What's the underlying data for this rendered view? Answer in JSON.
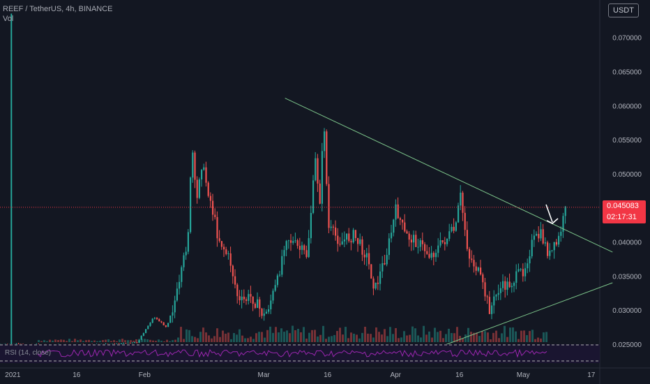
{
  "header": {
    "symbol": "REEF / TetherUS, 4h, BINANCE",
    "volume_label": "Vol"
  },
  "currency_button": "USDT",
  "price_tag": {
    "price": "0.045083",
    "countdown": "02:17:31"
  },
  "rsi_label": "RSI (14, close)",
  "colors": {
    "background": "#131722",
    "up": "#26a69a",
    "down": "#ef5350",
    "trendline": "#7cc48a",
    "price_line": "#f23645",
    "rsi": "#9c27b0",
    "text": "#b2b5be"
  },
  "chart_data": {
    "type": "candlestick",
    "title": "REEF / TetherUS, 4h, BINANCE",
    "y_axis": {
      "scale": "linear",
      "ticks": [
        0.025,
        0.03,
        0.035,
        0.04,
        0.045,
        0.05,
        0.055,
        0.06,
        0.065,
        0.07
      ],
      "tick_labels": [
        "0.025000",
        "0.030000",
        "0.035000",
        "0.040000",
        "0.045000",
        "0.050000",
        "0.055000",
        "0.060000",
        "0.065000",
        "0.070000"
      ],
      "range": [
        0.0215,
        0.0755
      ]
    },
    "x_axis": {
      "range": [
        "2020-12-29",
        "2021-05-19"
      ],
      "ticks": [
        {
          "date": "2021-01-01",
          "label": "2021"
        },
        {
          "date": "2021-01-16",
          "label": "16"
        },
        {
          "date": "2021-02-01",
          "label": "Feb"
        },
        {
          "date": "2021-03-01",
          "label": "Mar"
        },
        {
          "date": "2021-03-16",
          "label": "16"
        },
        {
          "date": "2021-04-01",
          "label": "Apr"
        },
        {
          "date": "2021-04-16",
          "label": "16"
        },
        {
          "date": "2021-05-01",
          "label": "May"
        },
        {
          "date": "2021-05-17",
          "label": "17"
        }
      ]
    },
    "series": [
      {
        "name": "REEF/USDT",
        "points": [
          {
            "date": "2020-12-29",
            "price": 0.0249
          },
          {
            "date": "2021-01-02",
            "price": 0.025
          },
          {
            "date": "2021-01-10",
            "price": 0.0248
          },
          {
            "date": "2021-01-20",
            "price": 0.0249
          },
          {
            "date": "2021-01-30",
            "price": 0.0252
          },
          {
            "date": "2021-02-03",
            "price": 0.029
          },
          {
            "date": "2021-02-06",
            "price": 0.0275
          },
          {
            "date": "2021-02-09",
            "price": 0.0335
          },
          {
            "date": "2021-02-11",
            "price": 0.041
          },
          {
            "date": "2021-02-12",
            "price": 0.054
          },
          {
            "date": "2021-02-13",
            "price": 0.045
          },
          {
            "date": "2021-02-14",
            "price": 0.052
          },
          {
            "date": "2021-02-16",
            "price": 0.047
          },
          {
            "date": "2021-02-18",
            "price": 0.041
          },
          {
            "date": "2021-02-21",
            "price": 0.037
          },
          {
            "date": "2021-02-23",
            "price": 0.031
          },
          {
            "date": "2021-02-26",
            "price": 0.032
          },
          {
            "date": "2021-03-01",
            "price": 0.029
          },
          {
            "date": "2021-03-04",
            "price": 0.034
          },
          {
            "date": "2021-03-06",
            "price": 0.041
          },
          {
            "date": "2021-03-09",
            "price": 0.039
          },
          {
            "date": "2021-03-11",
            "price": 0.038
          },
          {
            "date": "2021-03-13",
            "price": 0.052
          },
          {
            "date": "2021-03-14",
            "price": 0.046
          },
          {
            "date": "2021-03-15",
            "price": 0.058
          },
          {
            "date": "2021-03-16",
            "price": 0.042
          },
          {
            "date": "2021-03-19",
            "price": 0.04
          },
          {
            "date": "2021-03-22",
            "price": 0.041
          },
          {
            "date": "2021-03-25",
            "price": 0.038
          },
          {
            "date": "2021-03-27",
            "price": 0.033
          },
          {
            "date": "2021-03-30",
            "price": 0.039
          },
          {
            "date": "2021-04-01",
            "price": 0.045
          },
          {
            "date": "2021-04-03",
            "price": 0.041
          },
          {
            "date": "2021-04-06",
            "price": 0.04
          },
          {
            "date": "2021-04-09",
            "price": 0.038
          },
          {
            "date": "2021-04-12",
            "price": 0.04
          },
          {
            "date": "2021-04-15",
            "price": 0.042
          },
          {
            "date": "2021-04-16",
            "price": 0.047
          },
          {
            "date": "2021-04-18",
            "price": 0.038
          },
          {
            "date": "2021-04-20",
            "price": 0.036
          },
          {
            "date": "2021-04-23",
            "price": 0.03
          },
          {
            "date": "2021-04-25",
            "price": 0.033
          },
          {
            "date": "2021-04-28",
            "price": 0.034
          },
          {
            "date": "2021-05-01",
            "price": 0.036
          },
          {
            "date": "2021-05-03",
            "price": 0.04
          },
          {
            "date": "2021-05-05",
            "price": 0.041
          },
          {
            "date": "2021-05-07",
            "price": 0.038
          },
          {
            "date": "2021-05-09",
            "price": 0.04
          },
          {
            "date": "2021-05-11",
            "price": 0.0451
          }
        ]
      }
    ],
    "trendlines": [
      {
        "name": "upper",
        "from": {
          "date": "2021-03-06",
          "price": 0.0611
        },
        "to": {
          "date": "2021-05-22",
          "price": 0.0385
        }
      },
      {
        "name": "lower",
        "from": {
          "date": "2021-04-11",
          "price": 0.0245
        },
        "to": {
          "date": "2021-05-22",
          "price": 0.034
        }
      }
    ],
    "last_price": 0.045083,
    "grid": false,
    "legend": "top-left"
  }
}
